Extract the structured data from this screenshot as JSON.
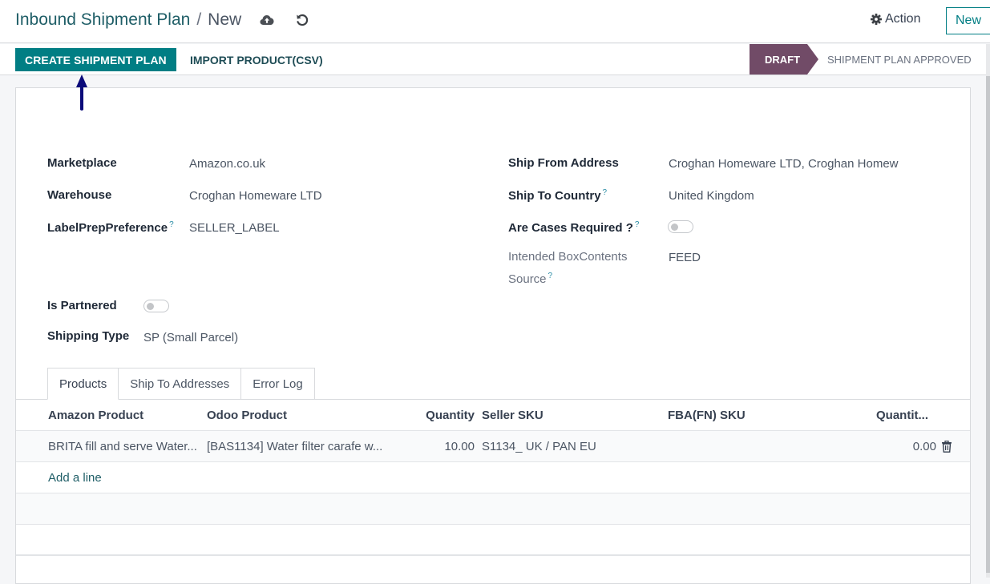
{
  "header": {
    "breadcrumb_parent": "Inbound Shipment Plan",
    "breadcrumb_separator": "/",
    "breadcrumb_current": "New",
    "save_icon": "cloud-upload-icon",
    "discard_icon": "undo-icon",
    "action_label": "Action",
    "action_icon": "gear-icon",
    "new_label": "New"
  },
  "statusbar": {
    "buttons": [
      {
        "label": "CREATE SHIPMENT PLAN",
        "style": "primary"
      },
      {
        "label": "IMPORT PRODUCT(CSV)",
        "style": "secondary"
      }
    ],
    "stages": [
      {
        "label": "DRAFT",
        "active": true
      },
      {
        "label": "SHIPMENT PLAN APPROVED",
        "active": false
      }
    ]
  },
  "annotation": {
    "icon": "arrow-up-icon",
    "color": "#0b0b7a"
  },
  "form": {
    "left": {
      "marketplace": {
        "label": "Marketplace",
        "value": "Amazon.co.uk"
      },
      "warehouse": {
        "label": "Warehouse",
        "value": "Croghan Homeware LTD"
      },
      "label_prep": {
        "label": "LabelPrepPreference",
        "help": "?",
        "value": "SELLER_LABEL"
      },
      "is_partnered": {
        "label": "Is Partnered",
        "value": false
      },
      "shipping_type": {
        "label": "Shipping Type",
        "value": "SP (Small Parcel)"
      }
    },
    "right": {
      "ship_from": {
        "label": "Ship From Address",
        "value": "Croghan Homeware LTD, Croghan Homew"
      },
      "ship_to_country": {
        "label": "Ship To Country",
        "help": "?",
        "value": "United Kingdom"
      },
      "cases_required": {
        "label": "Are Cases Required ?",
        "help": "?",
        "value": false
      },
      "box_contents": {
        "label_line1": "Intended BoxContents",
        "label_line2": "Source",
        "help": "?",
        "value": "FEED"
      }
    }
  },
  "tabs": [
    {
      "label": "Products",
      "active": true
    },
    {
      "label": "Ship To Addresses",
      "active": false
    },
    {
      "label": "Error Log",
      "active": false
    }
  ],
  "table": {
    "columns": [
      "Amazon Product",
      "Odoo Product",
      "Quantity",
      "Seller SKU",
      "FBA(FN) SKU",
      "Quantit..."
    ],
    "rows": [
      {
        "amazon_product": "BRITA fill and serve Water...",
        "odoo_product": "[BAS1134] Water filter carafe w...",
        "quantity": "10.00",
        "seller_sku": "S1134_ UK / PAN EU",
        "fba_sku": "",
        "quantity_shipped": "0.00",
        "delete_icon": "trash-icon"
      }
    ],
    "add_line_label": "Add a line"
  },
  "colors": {
    "primary": "#017e84",
    "stage_active": "#714b67",
    "link": "#1f5e67",
    "help": "#2c8ea6"
  }
}
